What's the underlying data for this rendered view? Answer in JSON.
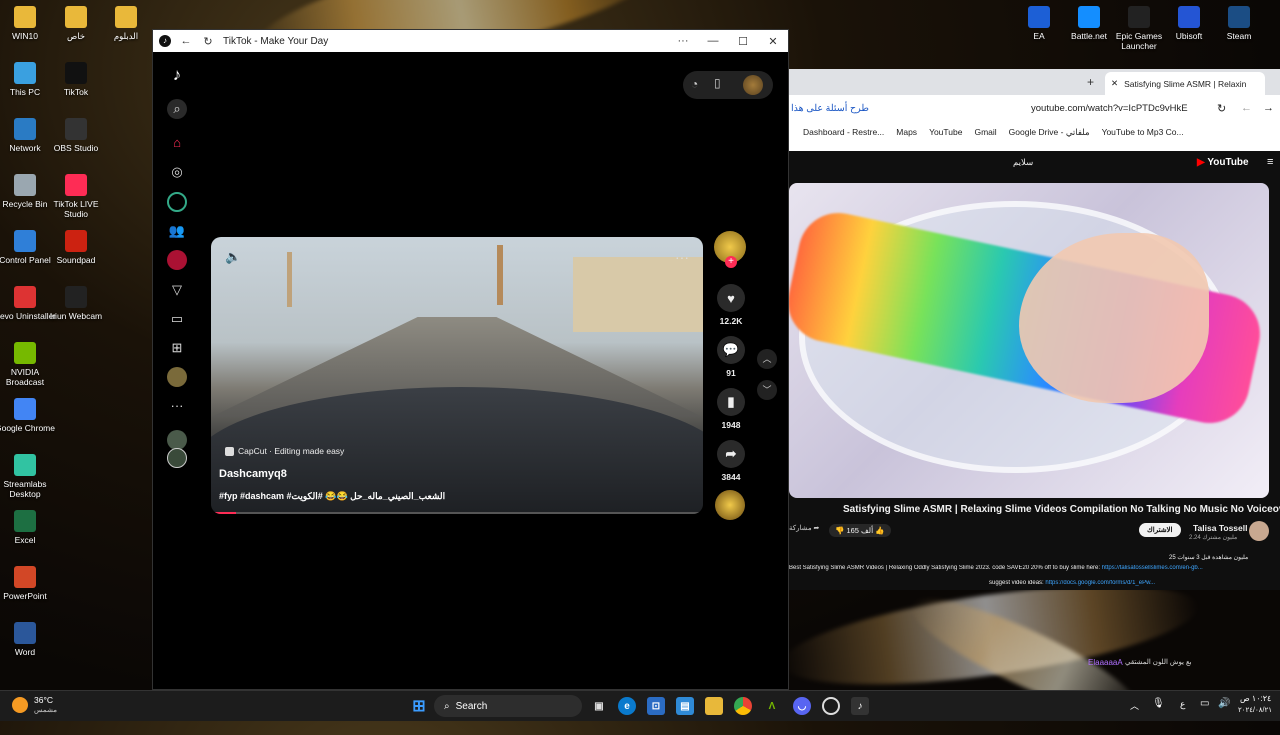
{
  "desktop_left": [
    {
      "label": "WIN10",
      "icon": "folder-icon",
      "color": "#e9b83a"
    },
    {
      "label": "This PC",
      "icon": "monitor-icon",
      "color": "#3aa0e0"
    },
    {
      "label": "Network",
      "icon": "network-icon",
      "color": "#2a7bc4"
    },
    {
      "label": "Recycle Bin",
      "icon": "recycle-bin-icon",
      "color": "#9aa7b0"
    },
    {
      "label": "Control Panel",
      "icon": "control-panel-icon",
      "color": "#2f7fd8"
    },
    {
      "label": "Revo Uninstaller",
      "icon": "revo-icon",
      "color": "#d33"
    },
    {
      "label": "NVIDIA Broadcast",
      "icon": "nvidia-icon",
      "color": "#76b900"
    },
    {
      "label": "Google Chrome",
      "icon": "chrome-icon",
      "color": "#4285f4"
    },
    {
      "label": "Streamlabs Desktop",
      "icon": "streamlabs-icon",
      "color": "#31c3a2"
    },
    {
      "label": "Excel",
      "icon": "excel-icon",
      "color": "#1d6f42"
    },
    {
      "label": "PowerPoint",
      "icon": "powerpoint-icon",
      "color": "#d24726"
    },
    {
      "label": "Word",
      "icon": "word-icon",
      "color": "#2b579a"
    }
  ],
  "desktop_col2": [
    {
      "label": "خاص",
      "icon": "folder-icon",
      "color": "#e9b83a"
    },
    {
      "label": "TikTok",
      "icon": "tiktok-icon",
      "color": "#111"
    },
    {
      "label": "OBS Studio",
      "icon": "obs-icon",
      "color": "#333"
    },
    {
      "label": "TikTok LIVE Studio",
      "icon": "tiktok-live-icon",
      "color": "#fe2c55"
    },
    {
      "label": "Soundpad",
      "icon": "soundpad-icon",
      "color": "#c21"
    },
    {
      "label": "Iriun Webcam",
      "icon": "iriun-icon",
      "color": "#222"
    }
  ],
  "desktop_top": [
    {
      "label": "الدبلوم",
      "icon": "folder-icon",
      "color": "#e9b83a"
    }
  ],
  "desktop_right": [
    {
      "label": "EA",
      "icon": "ea-icon",
      "color": "#1c5fd6"
    },
    {
      "label": "Battle.net",
      "icon": "battlenet-icon",
      "color": "#148eff"
    },
    {
      "label": "Epic Games Launcher",
      "icon": "epic-icon",
      "color": "#222"
    },
    {
      "label": "Ubisoft",
      "icon": "ubisoft-icon",
      "color": "#2455d4"
    },
    {
      "label": "Steam",
      "icon": "steam-icon",
      "color": "#1b4d84"
    }
  ],
  "tiktok": {
    "window_title": "TikTok - Make Your Day",
    "menu_dots": "···",
    "video": {
      "mute_icon": "speaker-icon",
      "more": "···",
      "source_label": "CapCut · Editing made easy",
      "author": "Dashcamyq8",
      "caption": "#fyp #dashcam #الشعب_الصيني_ماله_حل 😂😂 #الكويت"
    },
    "actions": {
      "likes": "12.2K",
      "comments": "91",
      "saves": "1948",
      "shares": "3844"
    },
    "accent": "#fe2c55"
  },
  "chrome": {
    "tab_title": "Satisfying Slime ASMR | Relaxin",
    "search_chip": "طرح أسئلة على هذا",
    "url": "youtube.com/watch?v=IcPTDc9vHkE",
    "bookmarks": [
      "Dashboard - Restre...",
      "Maps",
      "YouTube",
      "Gmail",
      "Google Drive - ملفاتي",
      "YouTube to Mp3 Co..."
    ],
    "yt_search": "سلايم",
    "yt_logo": "YouTube",
    "video_title": "Satisfying Slime ASMR | Relaxing Slime Videos Compilation No Talking No Music No Voiceover",
    "channel": "Talisa Tossell",
    "subscribers": "2.24 مليون مشترك",
    "subscribe": "الاشتراك",
    "likes": "165 ألف",
    "share": "مشاركة",
    "views_line": "25 مليون مشاهدة قبل 3 سنوات",
    "desc_line1": "Best Satisfying Slime ASMR Videos | Relaxing Oddly Satisfying Slime 2023. code SAVE20 20% off to buy slime here:",
    "desc_link1": "https://talisatossellslimes.com/en-gb...",
    "desc_line2": "suggest video ideas:",
    "desc_link2": "https://docs.google.com/forms/d/1_ePw..."
  },
  "overlay_text": "ElaaaaaA",
  "overlay_text2": "بع يوش اللون المشتقي",
  "taskbar": {
    "weather_temp": "36°C",
    "weather_desc": "مشمس",
    "search_label": "Search",
    "time": "١٠:٢٤ ص",
    "date": "٢٠٢٤/٠٨/٢١",
    "lang": "ع"
  }
}
